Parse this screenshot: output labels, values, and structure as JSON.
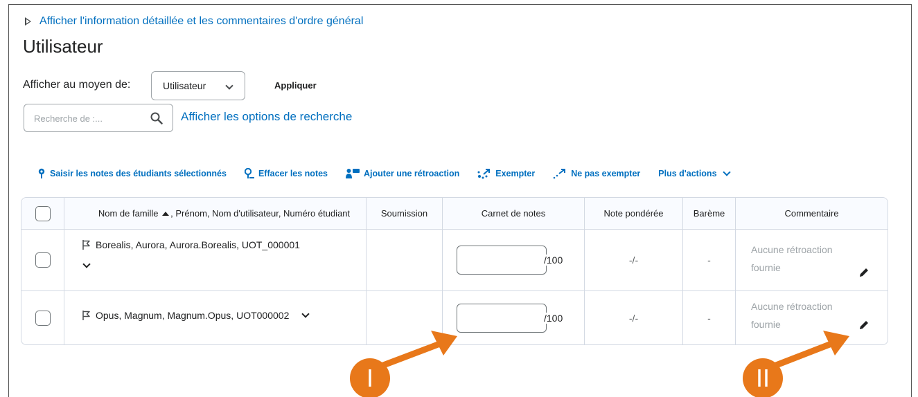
{
  "details_toggle": {
    "label": "Afficher l'information détaillée et les commentaires d'ordre général"
  },
  "page_title": "Utilisateur",
  "view_by": {
    "label": "Afficher au moyen de:",
    "selected": "Utilisateur",
    "apply_label": "Appliquer"
  },
  "search": {
    "placeholder": "Recherche de :...",
    "options_link": "Afficher les options de recherche"
  },
  "toolbar": {
    "enter_grades": "Saisir les notes des étudiants sélectionnés",
    "clear_grades": "Effacer les notes",
    "add_feedback": "Ajouter une rétroaction",
    "exempt": "Exempter",
    "unexempt": "Ne pas exempter",
    "more_actions": "Plus d'actions"
  },
  "table": {
    "headers": {
      "name_sort": "Nom de famille",
      "name_rest": ", Prénom, Nom d'utilisateur, Numéro étudiant",
      "submission": "Soumission",
      "gradebook": "Carnet de notes",
      "weighted_grade": "Note pondérée",
      "scheme": "Barème",
      "comment": "Commentaire"
    },
    "rows": [
      {
        "name": "Borealis, Aurora, Aurora.Borealis, UOT_000001",
        "grade_value": "",
        "grade_max": "/100",
        "weighted": "-/-",
        "scheme": "-",
        "comment_line1": "Aucune rétroaction",
        "comment_line2": "fournie"
      },
      {
        "name": "Opus, Magnum, Magnum.Opus, UOT000002",
        "grade_value": "",
        "grade_max": "/100",
        "weighted": "-/-",
        "scheme": "-",
        "comment_line1": "Aucune rétroaction",
        "comment_line2": "fournie"
      }
    ]
  },
  "annotations": {
    "marker_1": "I",
    "marker_2": "II",
    "color": "#e8781a"
  },
  "colors": {
    "link": "#006fbf",
    "text": "#202122",
    "muted": "#9ea4a8",
    "border": "#d3d9e3"
  }
}
